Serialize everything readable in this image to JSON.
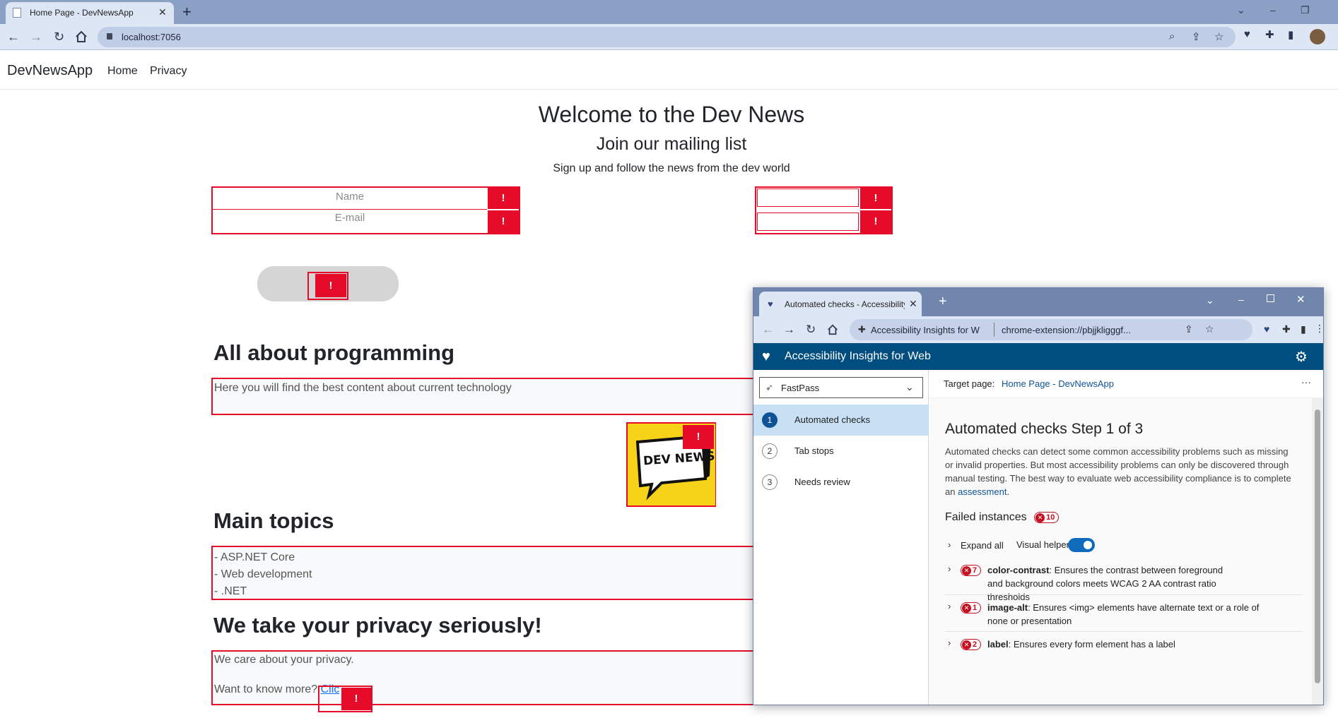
{
  "browser": {
    "tab_title": "Home Page - DevNewsApp",
    "url": "localhost:7056"
  },
  "site": {
    "brand": "DevNewsApp",
    "nav": [
      "Home",
      "Privacy"
    ],
    "hero_title": "Welcome to the Dev News",
    "hero_subtitle": "Join our mailing list",
    "hero_text": "Sign up and follow the news from the dev world",
    "name_placeholder": "Name",
    "email_placeholder": "E-mail",
    "fail_marker": "!",
    "section_programming": "All about programming",
    "programming_text": "Here you will find the best content about current technology",
    "logo_text": "DEV NEWS",
    "section_topics": "Main topics",
    "topics": [
      "- ASP.NET Core",
      "- Web development",
      "- .NET"
    ],
    "section_privacy": "We take your privacy seriously!",
    "privacy_text": "We care about your privacy.",
    "privacy_more": "Want to know more?",
    "privacy_link": "Clic"
  },
  "insights": {
    "tab_title": "Automated checks - Accessibility Insights for Web",
    "address_title": "Accessibility Insights for W",
    "address_url": "chrome-extension://pbjjkligggf...",
    "app_title": "Accessibility Insights for Web",
    "mode": "FastPass",
    "steps": [
      {
        "num": "1",
        "label": "Automated checks"
      },
      {
        "num": "2",
        "label": "Tab stops"
      },
      {
        "num": "3",
        "label": "Needs review"
      }
    ],
    "target_label": "Target page:",
    "target_page": "Home Page - DevNewsApp",
    "more": "···",
    "heading": "Automated checks Step 1 of 3",
    "description_pre": "Automated checks can detect some common accessibility problems such as missing or invalid properties. But most accessibility problems can only be discovered through manual testing. The best way to evaluate web accessibility compliance is to complete an",
    "description_link": "assessment",
    "description_post": ".",
    "failed_label": "Failed instances",
    "failed_count": "10",
    "expand_all": "Expand all",
    "visual_helper": "Visual helper",
    "visual_helper_on": true,
    "rules": [
      {
        "count": "7",
        "name": "color-contrast",
        "desc": ": Ensures the contrast between foreground and background colors meets WCAG 2 AA contrast ratio thresholds"
      },
      {
        "count": "1",
        "name": "image-alt",
        "desc": ": Ensures <img> elements have alternate text or a role of none or presentation"
      },
      {
        "count": "2",
        "name": "label",
        "desc": ": Ensures every form element has a label"
      }
    ]
  },
  "colors": {
    "fail_red": "#e50b29",
    "insights_header": "#004d7f",
    "active_step": "#c7e0f4"
  }
}
